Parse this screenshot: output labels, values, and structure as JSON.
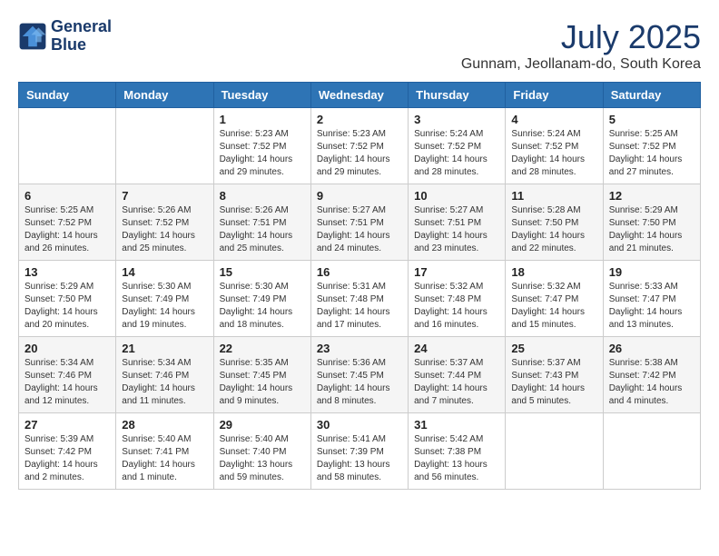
{
  "header": {
    "logo_line1": "General",
    "logo_line2": "Blue",
    "month": "July 2025",
    "location": "Gunnam, Jeollanam-do, South Korea"
  },
  "days_of_week": [
    "Sunday",
    "Monday",
    "Tuesday",
    "Wednesday",
    "Thursday",
    "Friday",
    "Saturday"
  ],
  "weeks": [
    [
      {
        "day": "",
        "info": ""
      },
      {
        "day": "",
        "info": ""
      },
      {
        "day": "1",
        "info": "Sunrise: 5:23 AM\nSunset: 7:52 PM\nDaylight: 14 hours and 29 minutes."
      },
      {
        "day": "2",
        "info": "Sunrise: 5:23 AM\nSunset: 7:52 PM\nDaylight: 14 hours and 29 minutes."
      },
      {
        "day": "3",
        "info": "Sunrise: 5:24 AM\nSunset: 7:52 PM\nDaylight: 14 hours and 28 minutes."
      },
      {
        "day": "4",
        "info": "Sunrise: 5:24 AM\nSunset: 7:52 PM\nDaylight: 14 hours and 28 minutes."
      },
      {
        "day": "5",
        "info": "Sunrise: 5:25 AM\nSunset: 7:52 PM\nDaylight: 14 hours and 27 minutes."
      }
    ],
    [
      {
        "day": "6",
        "info": "Sunrise: 5:25 AM\nSunset: 7:52 PM\nDaylight: 14 hours and 26 minutes."
      },
      {
        "day": "7",
        "info": "Sunrise: 5:26 AM\nSunset: 7:52 PM\nDaylight: 14 hours and 25 minutes."
      },
      {
        "day": "8",
        "info": "Sunrise: 5:26 AM\nSunset: 7:51 PM\nDaylight: 14 hours and 25 minutes."
      },
      {
        "day": "9",
        "info": "Sunrise: 5:27 AM\nSunset: 7:51 PM\nDaylight: 14 hours and 24 minutes."
      },
      {
        "day": "10",
        "info": "Sunrise: 5:27 AM\nSunset: 7:51 PM\nDaylight: 14 hours and 23 minutes."
      },
      {
        "day": "11",
        "info": "Sunrise: 5:28 AM\nSunset: 7:50 PM\nDaylight: 14 hours and 22 minutes."
      },
      {
        "day": "12",
        "info": "Sunrise: 5:29 AM\nSunset: 7:50 PM\nDaylight: 14 hours and 21 minutes."
      }
    ],
    [
      {
        "day": "13",
        "info": "Sunrise: 5:29 AM\nSunset: 7:50 PM\nDaylight: 14 hours and 20 minutes."
      },
      {
        "day": "14",
        "info": "Sunrise: 5:30 AM\nSunset: 7:49 PM\nDaylight: 14 hours and 19 minutes."
      },
      {
        "day": "15",
        "info": "Sunrise: 5:30 AM\nSunset: 7:49 PM\nDaylight: 14 hours and 18 minutes."
      },
      {
        "day": "16",
        "info": "Sunrise: 5:31 AM\nSunset: 7:48 PM\nDaylight: 14 hours and 17 minutes."
      },
      {
        "day": "17",
        "info": "Sunrise: 5:32 AM\nSunset: 7:48 PM\nDaylight: 14 hours and 16 minutes."
      },
      {
        "day": "18",
        "info": "Sunrise: 5:32 AM\nSunset: 7:47 PM\nDaylight: 14 hours and 15 minutes."
      },
      {
        "day": "19",
        "info": "Sunrise: 5:33 AM\nSunset: 7:47 PM\nDaylight: 14 hours and 13 minutes."
      }
    ],
    [
      {
        "day": "20",
        "info": "Sunrise: 5:34 AM\nSunset: 7:46 PM\nDaylight: 14 hours and 12 minutes."
      },
      {
        "day": "21",
        "info": "Sunrise: 5:34 AM\nSunset: 7:46 PM\nDaylight: 14 hours and 11 minutes."
      },
      {
        "day": "22",
        "info": "Sunrise: 5:35 AM\nSunset: 7:45 PM\nDaylight: 14 hours and 9 minutes."
      },
      {
        "day": "23",
        "info": "Sunrise: 5:36 AM\nSunset: 7:45 PM\nDaylight: 14 hours and 8 minutes."
      },
      {
        "day": "24",
        "info": "Sunrise: 5:37 AM\nSunset: 7:44 PM\nDaylight: 14 hours and 7 minutes."
      },
      {
        "day": "25",
        "info": "Sunrise: 5:37 AM\nSunset: 7:43 PM\nDaylight: 14 hours and 5 minutes."
      },
      {
        "day": "26",
        "info": "Sunrise: 5:38 AM\nSunset: 7:42 PM\nDaylight: 14 hours and 4 minutes."
      }
    ],
    [
      {
        "day": "27",
        "info": "Sunrise: 5:39 AM\nSunset: 7:42 PM\nDaylight: 14 hours and 2 minutes."
      },
      {
        "day": "28",
        "info": "Sunrise: 5:40 AM\nSunset: 7:41 PM\nDaylight: 14 hours and 1 minute."
      },
      {
        "day": "29",
        "info": "Sunrise: 5:40 AM\nSunset: 7:40 PM\nDaylight: 13 hours and 59 minutes."
      },
      {
        "day": "30",
        "info": "Sunrise: 5:41 AM\nSunset: 7:39 PM\nDaylight: 13 hours and 58 minutes."
      },
      {
        "day": "31",
        "info": "Sunrise: 5:42 AM\nSunset: 7:38 PM\nDaylight: 13 hours and 56 minutes."
      },
      {
        "day": "",
        "info": ""
      },
      {
        "day": "",
        "info": ""
      }
    ]
  ]
}
